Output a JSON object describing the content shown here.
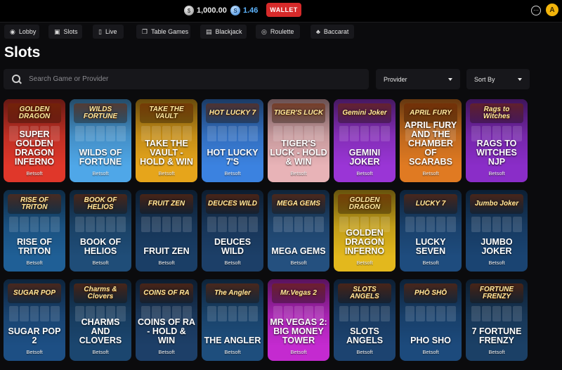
{
  "header": {
    "coins_balance": "1,000.00",
    "sweeps_balance": "1.46",
    "wallet_label": "WALLET",
    "avatar_initial": "A"
  },
  "categories": [
    {
      "label": "Lobby",
      "icon": "gamepad-icon"
    },
    {
      "label": "Slots",
      "icon": "slot-icon"
    },
    {
      "label": "Live",
      "icon": "phone-icon"
    },
    {
      "label": "Table Games",
      "icon": "cards-icon"
    },
    {
      "label": "Blackjack",
      "icon": "blackjack-icon"
    },
    {
      "label": "Roulette",
      "icon": "roulette-icon"
    },
    {
      "label": "Baccarat",
      "icon": "club-icon"
    }
  ],
  "page_title": "Slots",
  "search": {
    "placeholder": "Search Game or Provider"
  },
  "filters": {
    "provider_label": "Provider",
    "sort_label": "Sort By"
  },
  "games": [
    {
      "title": "Super Golden Dragon Inferno",
      "logo": "GOLDEN DRAGON",
      "provider": "Betsoft",
      "color": "#e0372a"
    },
    {
      "title": "Wilds of Fortune",
      "logo": "WILDS FORTUNE",
      "provider": "Betsoft",
      "color": "#4fa7e8"
    },
    {
      "title": "Take the Vault - Hold & Win",
      "logo": "TAKE THE VAULT",
      "provider": "Betsoft",
      "color": "#e6a51b"
    },
    {
      "title": "Hot Lucky 7's",
      "logo": "HOT LUCKY 7",
      "provider": "Betsoft",
      "color": "#3b82e0"
    },
    {
      "title": "Tiger's Luck - Hold & Win",
      "logo": "TIGER'S LUCK",
      "provider": "Betsoft",
      "color": "#e8b3b7"
    },
    {
      "title": "Gemini Joker",
      "logo": "Gemini Joker",
      "provider": "Betsoft",
      "color": "#9a35d6"
    },
    {
      "title": "April Fury and the Chamber of Scarabs",
      "logo": "APRIL FURY",
      "provider": "Betsoft",
      "color": "#e07a22"
    },
    {
      "title": "Rags to Witches NJP",
      "logo": "Rags to Witches",
      "provider": "Betsoft",
      "color": "#8a2dc8"
    },
    {
      "title": "Rise of Triton",
      "logo": "RISE OF TRITON",
      "provider": "Betsoft",
      "color": "#1f5f96"
    },
    {
      "title": "Book of Helios",
      "logo": "BOOK OF HELIOS",
      "provider": "Betsoft",
      "color": "#1f4d78"
    },
    {
      "title": "Fruit Zen",
      "logo": "FRUIT ZEN",
      "provider": "Betsoft",
      "color": "#1a3e66"
    },
    {
      "title": "Deuces Wild",
      "logo": "DEUCES WILD",
      "provider": "Betsoft",
      "color": "#1c3f68"
    },
    {
      "title": "Mega Gems",
      "logo": "MEGA GEMS",
      "provider": "Betsoft",
      "color": "#24507f"
    },
    {
      "title": "Golden Dragon Inferno",
      "logo": "GOLDEN DRAGON",
      "provider": "Betsoft",
      "color": "#e3b81d"
    },
    {
      "title": "Lucky Seven",
      "logo": "LUCKY 7",
      "provider": "Betsoft",
      "color": "#1e4c7e"
    },
    {
      "title": "Jumbo Joker",
      "logo": "Jumbo Joker",
      "provider": "Betsoft",
      "color": "#1a4472"
    },
    {
      "title": "Sugar Pop 2",
      "logo": "SUGAR POP",
      "provider": "Betsoft",
      "color": "#1d4f84"
    },
    {
      "title": "Charms and Clovers",
      "logo": "Charms & Clovers",
      "provider": "Betsoft",
      "color": "#1b466f"
    },
    {
      "title": "Coins of Ra - Hold & Win",
      "logo": "COINS OF RA",
      "provider": "Betsoft",
      "color": "#1d3f68"
    },
    {
      "title": "The Angler",
      "logo": "The Angler",
      "provider": "Betsoft",
      "color": "#1e4e7d"
    },
    {
      "title": "Mr Vegas 2: Big Money Tower",
      "logo": "Mr.Vegas 2",
      "provider": "Betsoft",
      "color": "#c42ad0"
    },
    {
      "title": "Slots Angels",
      "logo": "SLOTS ANGELS",
      "provider": "Betsoft",
      "color": "#1c4370"
    },
    {
      "title": "Pho Sho",
      "logo": "PHŌ SHŌ",
      "provider": "Betsoft",
      "color": "#1c4a7c"
    },
    {
      "title": "7 Fortune Frenzy",
      "logo": "FORTUNE FRENZY",
      "provider": "Betsoft",
      "color": "#1b4066"
    }
  ]
}
